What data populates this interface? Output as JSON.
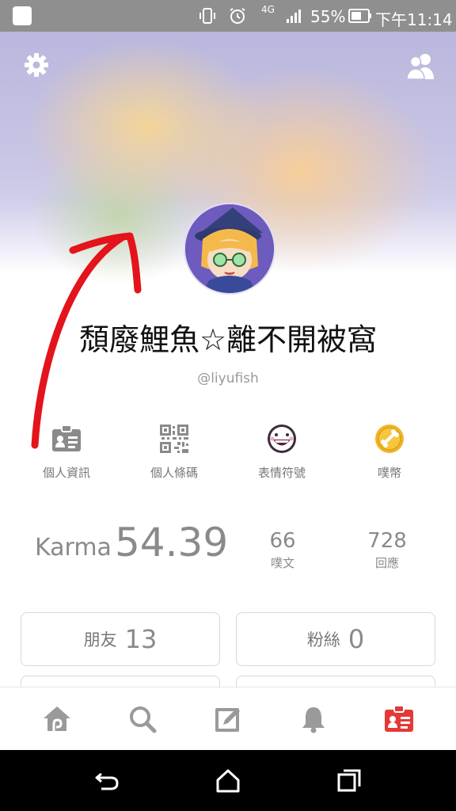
{
  "status_bar": {
    "battery_percent": "55%",
    "network": "4G",
    "time": "下午11:14"
  },
  "profile": {
    "display_name": "頹廢鯉魚☆離不開被窩",
    "username": "@liyufish"
  },
  "quick_actions": [
    {
      "label": "個人資訊",
      "icon": "profile-card-icon"
    },
    {
      "label": "個人條碼",
      "icon": "qr-code-icon"
    },
    {
      "label": "表情符號",
      "icon": "emoji-icon"
    },
    {
      "label": "噗幣",
      "icon": "coin-icon"
    }
  ],
  "stats": {
    "karma_label": "Karma",
    "karma_value": "54.39",
    "posts_count": "66",
    "posts_label": "噗文",
    "replies_count": "728",
    "replies_label": "回應"
  },
  "cards": {
    "friends_label": "朋友",
    "friends_count": "13",
    "fans_label": "粉絲",
    "fans_count": "0"
  },
  "tab_bar": [
    {
      "icon": "home-icon"
    },
    {
      "icon": "search-icon"
    },
    {
      "icon": "compose-icon"
    },
    {
      "icon": "notification-bell-icon"
    },
    {
      "icon": "profile-card-icon",
      "active": true
    }
  ],
  "colors": {
    "active_tab": "#e53935",
    "annotation_arrow": "#e3141b",
    "coin": "#f0b428"
  }
}
